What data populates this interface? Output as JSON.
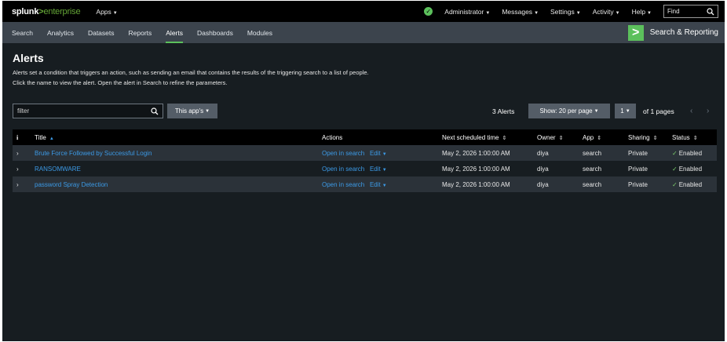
{
  "topbar": {
    "logo_a": "splunk",
    "logo_b": ">",
    "logo_c": "enterprise",
    "apps": "Apps",
    "status_icon": "check-circle-icon",
    "menus": [
      "Administrator",
      "Messages",
      "Settings",
      "Activity",
      "Help"
    ],
    "find_label": "Find"
  },
  "appbar": {
    "tabs": [
      "Search",
      "Analytics",
      "Datasets",
      "Reports",
      "Alerts",
      "Dashboards",
      "Modules"
    ],
    "active_tab": "Alerts",
    "app_name": "Search & Reporting",
    "app_logo": ">"
  },
  "main": {
    "title": "Alerts",
    "description": "Alerts set a condition that triggers an action, such as sending an email that contains the results of the triggering search to a list of people. Click the name to view the alert. Open the alert in Search to refine the parameters.",
    "filter_value": "filter",
    "apps_filter": "This app's",
    "alert_count": "3 Alerts",
    "per_page": "Show: 20 per page",
    "page_select": "1",
    "of_pages": "of 1 pages",
    "prev": "‹",
    "next": "›"
  },
  "table": {
    "headers": {
      "info": "i",
      "title": "Title",
      "actions": "Actions",
      "next_time": "Next scheduled time",
      "owner": "Owner",
      "app": "App",
      "sharing": "Sharing",
      "status": "Status"
    },
    "rows": [
      {
        "title": "Brute Force Followed by Successful Login",
        "open": "Open in search",
        "edit": "Edit",
        "next_time": "May 2, 2026 1:00:00 AM",
        "owner": "diya",
        "app": "search",
        "sharing": "Private",
        "status": "Enabled"
      },
      {
        "title": "RANSOMWARE",
        "open": "Open in search",
        "edit": "Edit",
        "next_time": "May 2, 2026 1:00:00 AM",
        "owner": "diya",
        "app": "search",
        "sharing": "Private",
        "status": "Enabled"
      },
      {
        "title": "password Spray Detection",
        "open": "Open in search",
        "edit": "Edit",
        "next_time": "May 2, 2026 1:00:00 AM",
        "owner": "diya",
        "app": "search",
        "sharing": "Private",
        "status": "Enabled"
      }
    ]
  },
  "colors": {
    "accent_green": "#5cc05c",
    "link_blue": "#3c9ae6",
    "background": "#171d21"
  }
}
